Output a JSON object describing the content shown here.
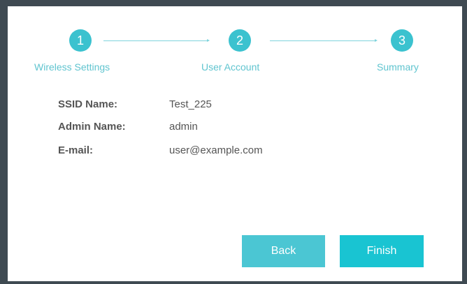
{
  "wizard": {
    "steps": [
      {
        "number": "1",
        "label": "Wireless Settings"
      },
      {
        "number": "2",
        "label": "User Account"
      },
      {
        "number": "3",
        "label": "Summary"
      }
    ]
  },
  "summary": {
    "fields": [
      {
        "label": "SSID Name:",
        "value": "Test_225"
      },
      {
        "label": "Admin Name:",
        "value": "admin"
      },
      {
        "label": "E-mail:",
        "value": "user@example.com"
      }
    ]
  },
  "actions": {
    "back_label": "Back",
    "finish_label": "Finish"
  },
  "colors": {
    "accent": "#3bc2cf",
    "finish_button": "#19c4d2",
    "back_button": "#4bc6d3",
    "frame": "#3f4a52"
  }
}
